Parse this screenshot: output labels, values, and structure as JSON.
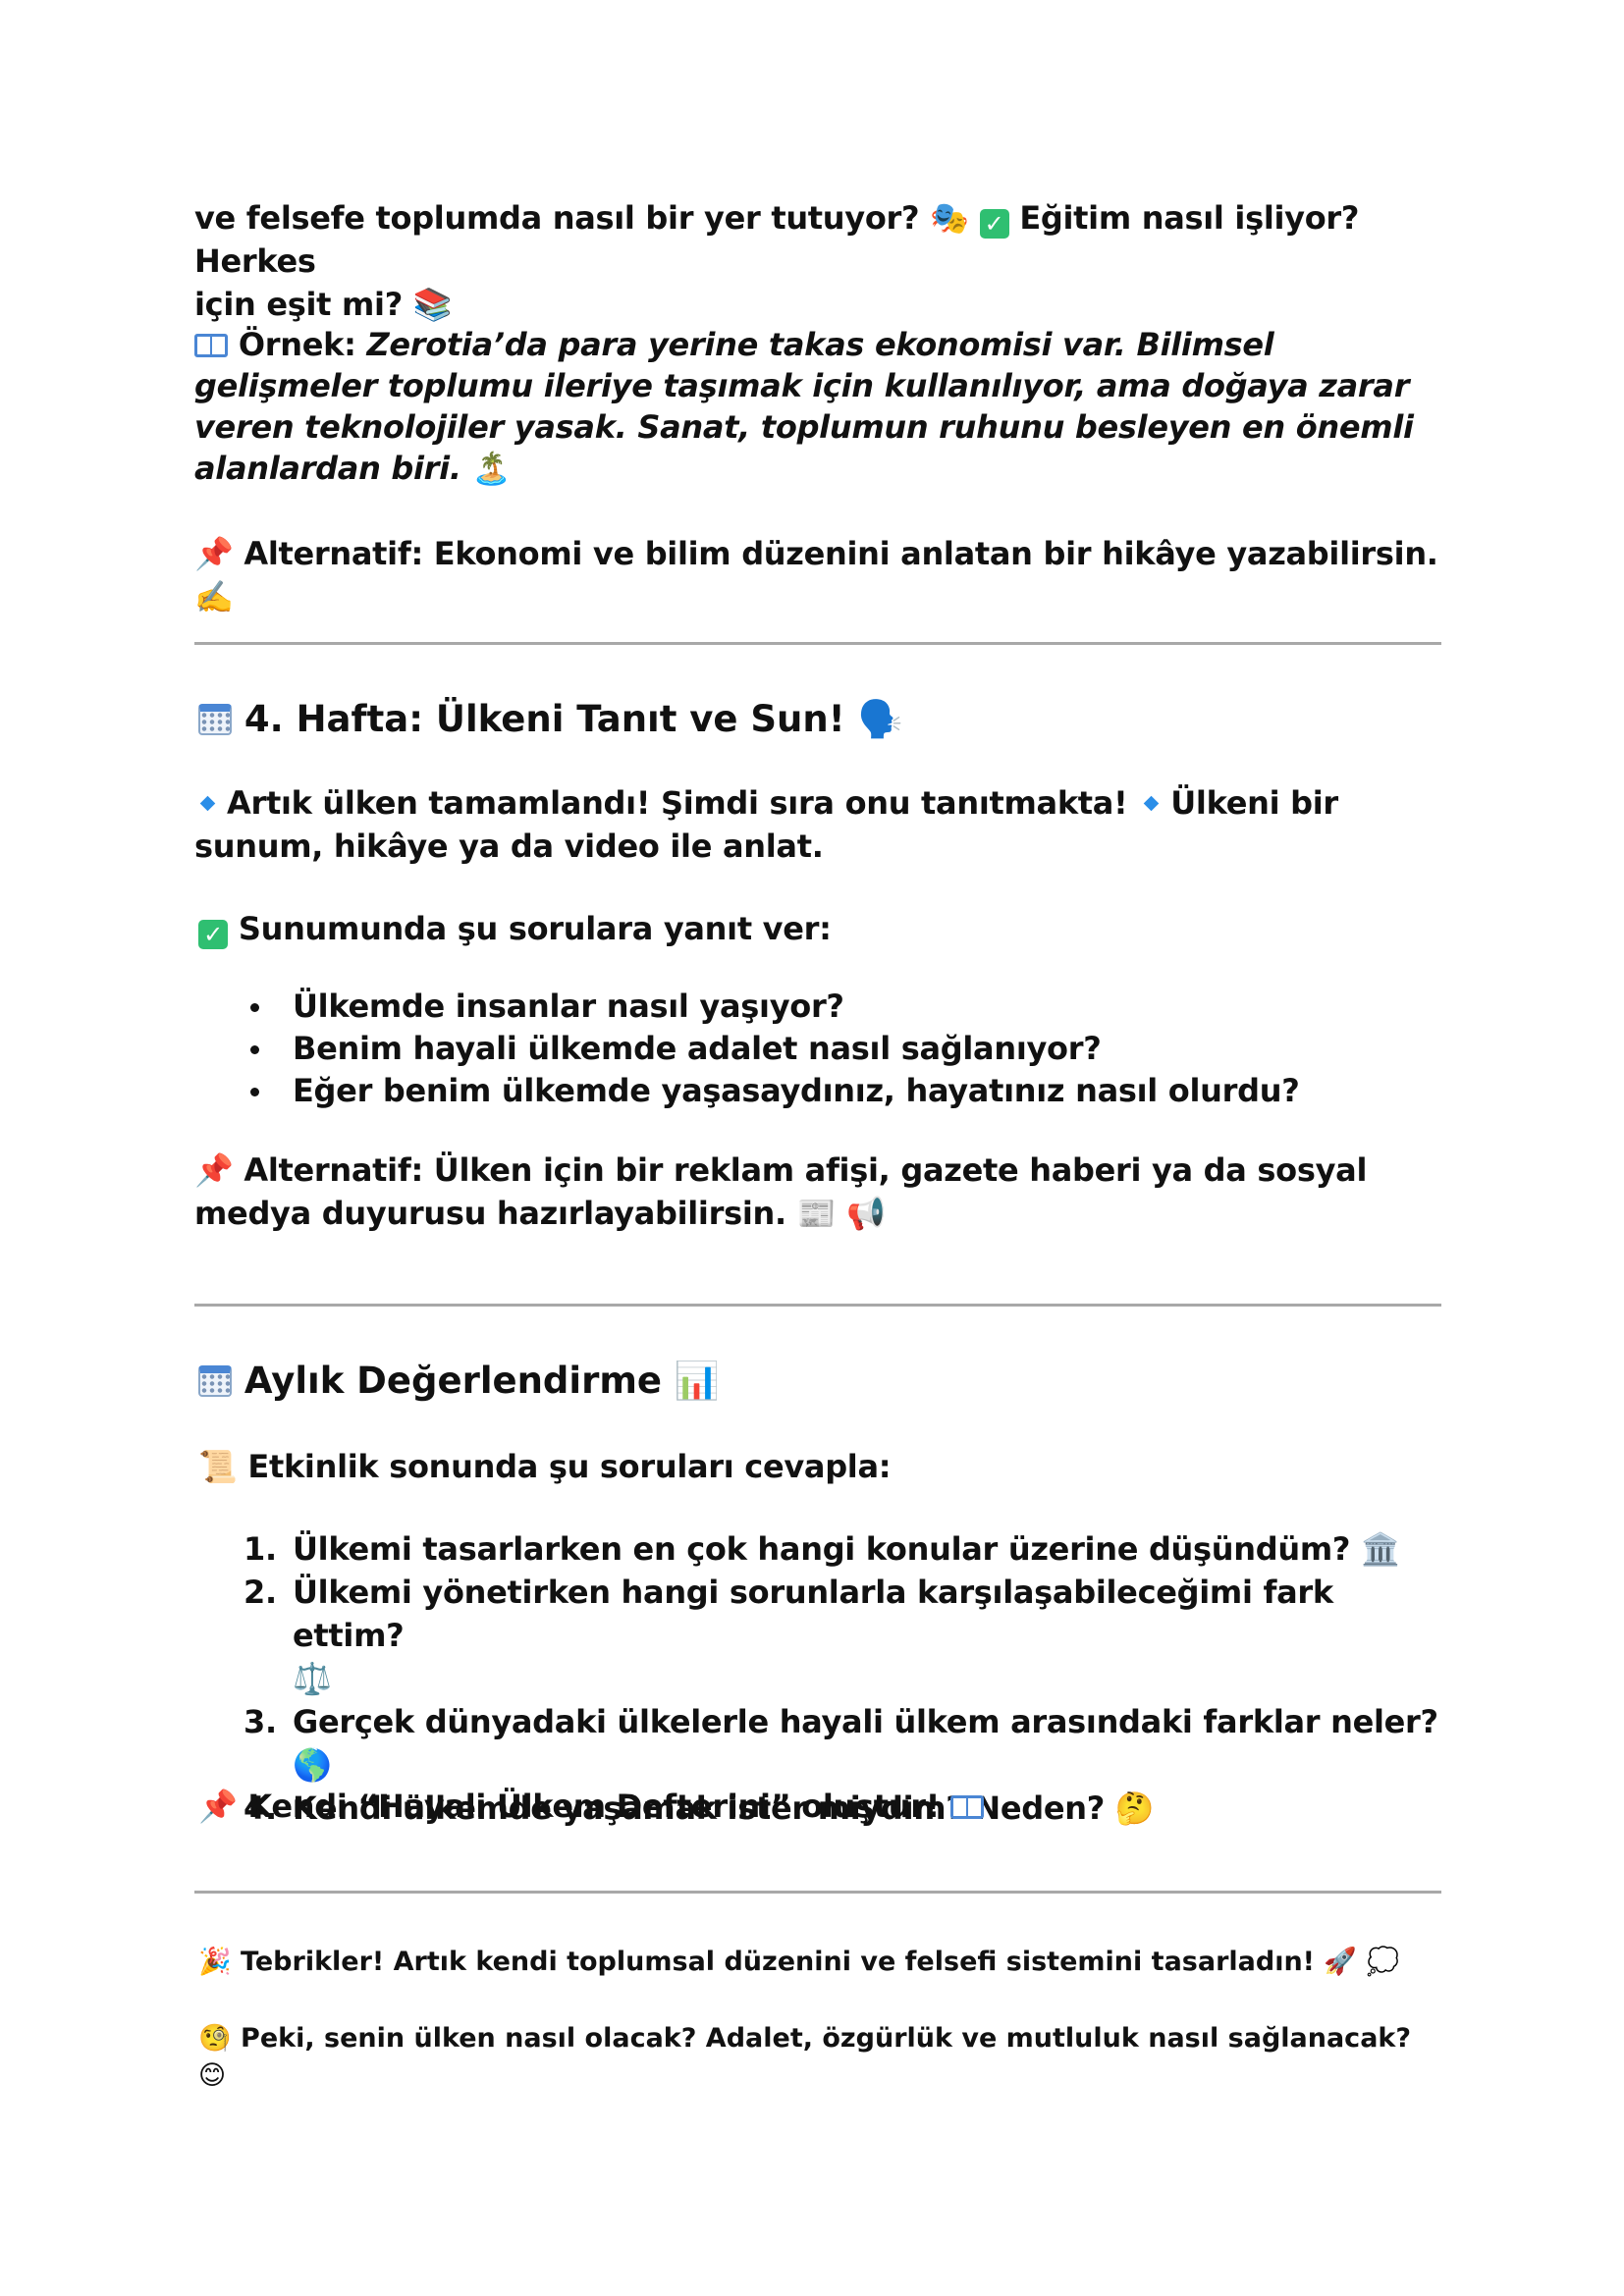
{
  "section3_tail": {
    "line1": "ve felsefe toplumda nasıl bir yer tutuyor?",
    "line1_b": "Eğitim nasıl işliyor? Herkes",
    "line2": "için eşit mi?",
    "example_label": "Örnek:",
    "example_text": "Zerotia’da para yerine takas ekonomisi var. Bilimsel gelişmeler toplumu ileriye taşımak için kullanılıyor, ama doğaya zarar veren teknolojiler yasak. Sanat, toplumun ruhunu besleyen en önemli alanlardan biri.",
    "alternative": "Alternatif: Ekonomi ve bilim düzenini anlatan bir hikâye yazabilirsin."
  },
  "week4": {
    "title": "4. Hafta: Ülkeni Tanıt ve Sun!",
    "intro_a": "Artık ülken tamamlandı! Şimdi sıra onu tanıtmakta!",
    "intro_b": "Ülkeni bir sunum, hikâye ya da video ile anlat.",
    "questions_label": "Sunumunda şu sorulara yanıt ver:",
    "questions": [
      "Ülkemde insanlar nasıl yaşıyor?",
      "Benim hayali ülkemde adalet nasıl sağlanıyor?",
      "Eğer benim ülkemde yaşasaydınız, hayatınız nasıl olurdu?"
    ],
    "alternative": "Alternatif: Ülken için bir reklam afişi, gazete haberi ya da sosyal medya duyurusu hazırlayabilirsin."
  },
  "monthly": {
    "title": "Aylık Değerlendirme",
    "intro": "Etkinlik sonunda şu soruları cevapla:",
    "items": [
      {
        "num": "1.",
        "text": "Ülkemi tasarlarken en çok hangi konular üzerine düşündüm?"
      },
      {
        "num": "2.",
        "text": "Ülkemi yönetirken hangi sorunlarla karşılaşabileceğimi fark ettim?"
      },
      {
        "num": "3.",
        "text": "Gerçek dünyadaki ülkelerle hayali ülkem arasındaki farklar neler?"
      },
      {
        "num": "4.",
        "text": "Kendi ülkemde yaşamak ister miydim? Neden?"
      }
    ],
    "closing": "Kendi “Hayali Ülkem Defterini” oluştur!"
  },
  "footer": {
    "congrats": "Tebrikler! Artık kendi toplumsal düzenini ve felsefi sistemini tasarladın!",
    "question": "Peki, senin ülken nasıl olacak? Adalet, özgürlük ve mutluluk nasıl sağlanacak?"
  },
  "icons": [
    "theater-masks-icon",
    "check-mark-icon",
    "books-icon",
    "open-book-icon",
    "palm-island-icon",
    "pushpin-icon",
    "writing-hand-icon",
    "calendar-icon",
    "speaking-head-icon",
    "diamond-icon",
    "newspaper-icon",
    "megaphone-icon",
    "bar-chart-icon",
    "scroll-icon",
    "classical-building-icon",
    "scales-icon",
    "globe-icon",
    "thinking-face-icon",
    "party-popper-icon",
    "rocket-icon",
    "thought-bubble-icon",
    "face-with-monocle-icon",
    "smiling-face-icon"
  ]
}
